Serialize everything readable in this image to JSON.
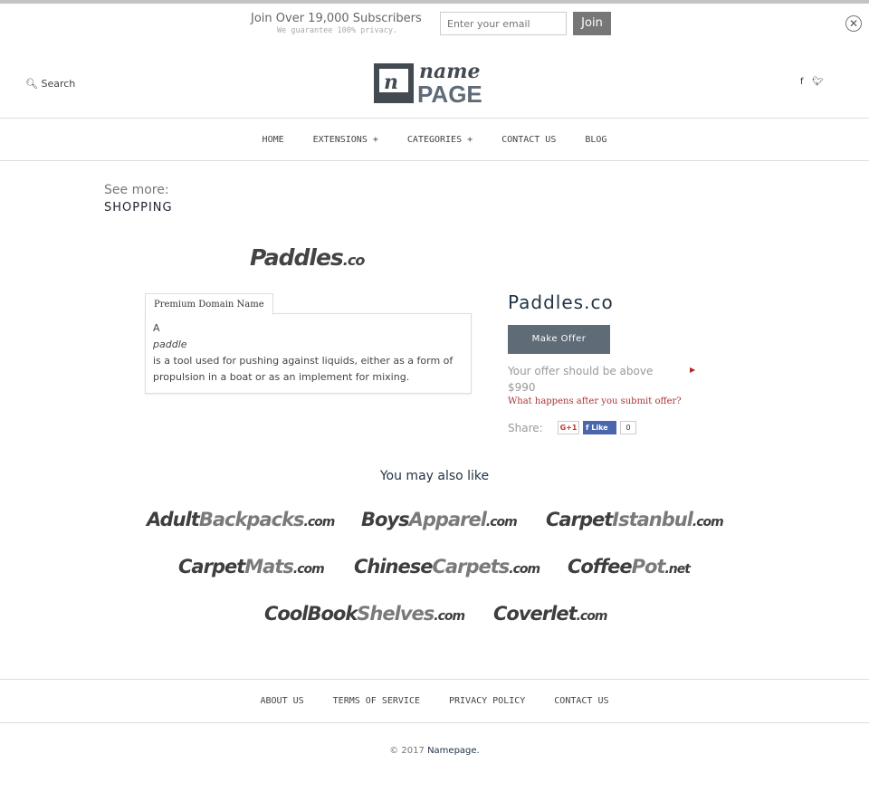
{
  "subscribe": {
    "title": "Join Over 19,000 Subscribers",
    "note": "We guarantee 100% privacy.",
    "placeholder": "Enter your email",
    "join": "Join"
  },
  "header": {
    "search": "Search",
    "logo_text": "namePAGE",
    "icons": [
      "facebook-icon",
      "twitter-icon"
    ]
  },
  "nav": [
    "HOME",
    "EXTENSIONS +",
    "CATEGORIES +",
    "CONTACT US",
    "BLOG"
  ],
  "see_more": {
    "label": "See more:",
    "category": "SHOPPING"
  },
  "domain": {
    "logo_main": "Paddles",
    "logo_tld": ".co",
    "tab": "Premium Domain Name",
    "desc": [
      "A",
      "paddle",
      "is a tool used for pushing against liquids, either as a form of",
      "propulsion in a boat or as an implement for mixing."
    ],
    "name": "Paddles.co",
    "make_offer": "Make Offer",
    "offer_note": "Your offer should be above",
    "price": "$990",
    "what_happens": "What happens after you submit offer?",
    "share": "Share:",
    "gplus": "G+1",
    "fb_like": "Like",
    "like_count": "0"
  },
  "also": {
    "title": "You may also like",
    "items": [
      {
        "d": "Adult",
        "l": "Backpacks",
        "t": ".com"
      },
      {
        "d": "Boys",
        "l": "Apparel",
        "t": ".com"
      },
      {
        "d": "Carpet",
        "l": "Istanbul",
        "t": ".com"
      },
      {
        "d": "Carpet",
        "l": "Mats",
        "t": ".com"
      },
      {
        "d": "Chinese",
        "l": "Carpets",
        "t": ".com"
      },
      {
        "d": "Coffee",
        "l": "Pot",
        "t": ".net"
      },
      {
        "d": "CoolBook",
        "l": "Shelves",
        "t": ".com"
      },
      {
        "d": "Coverlet",
        "l": "",
        "t": ".com"
      }
    ]
  },
  "footer": {
    "links": [
      "ABOUT US",
      "TERMS OF SERVICE",
      "PRIVACY POLICY",
      "CONTACT US"
    ],
    "copy": "© 2017",
    "brand": "Namepage."
  },
  "colors": {
    "button": "#5f6c78",
    "link_red": "#a33",
    "facebook": "#4a66ad"
  }
}
